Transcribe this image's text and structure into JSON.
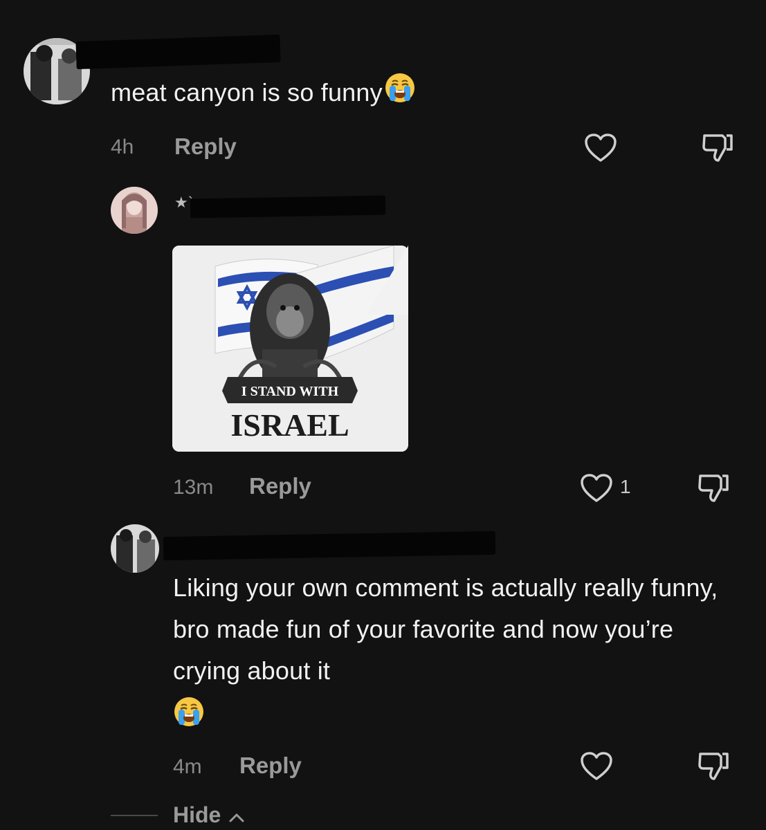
{
  "comments": [
    {
      "text": "meat canyon is so funny",
      "emoji": "crying-face",
      "time": "4h",
      "reply_label": "Reply"
    },
    {
      "username_prefix": "★`",
      "image": {
        "banner_line1": "I STAND WITH",
        "banner_line2": "ISRAEL",
        "flag_color": "#2b4fb3"
      },
      "time": "13m",
      "reply_label": "Reply",
      "like_count": "1"
    },
    {
      "text": "Liking your own comment is actually really funny, bro made fun of your favorite and now you’re crying about it",
      "emoji": "crying-face",
      "time": "4m",
      "reply_label": "Reply"
    }
  ],
  "hide": {
    "label": "Hide",
    "chevron": "^"
  },
  "colors": {
    "background": "#121212",
    "text": "#f2f2f2",
    "muted": "#9a9a9a"
  }
}
